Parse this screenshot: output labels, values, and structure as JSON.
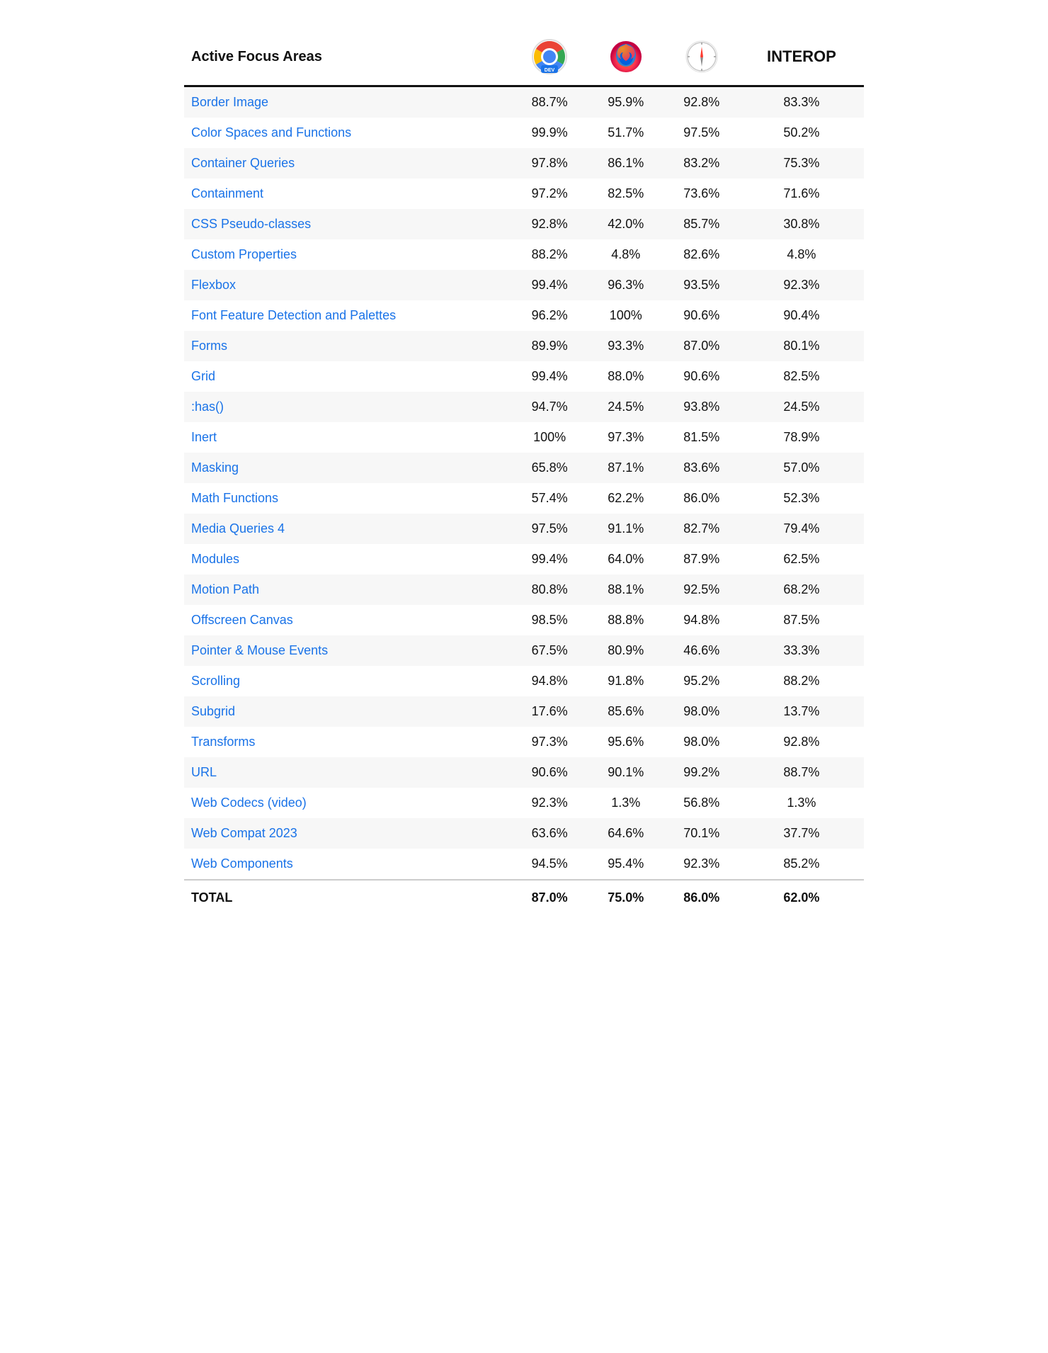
{
  "header": {
    "col_name": "Active Focus Areas",
    "col_interop": "INTEROP"
  },
  "rows": [
    {
      "name": "Border Image",
      "chrome": "88.7%",
      "firefox": "95.9%",
      "safari": "92.8%",
      "interop": "83.3%"
    },
    {
      "name": "Color Spaces and Functions",
      "chrome": "99.9%",
      "firefox": "51.7%",
      "safari": "97.5%",
      "interop": "50.2%"
    },
    {
      "name": "Container Queries",
      "chrome": "97.8%",
      "firefox": "86.1%",
      "safari": "83.2%",
      "interop": "75.3%"
    },
    {
      "name": "Containment",
      "chrome": "97.2%",
      "firefox": "82.5%",
      "safari": "73.6%",
      "interop": "71.6%"
    },
    {
      "name": "CSS Pseudo-classes",
      "chrome": "92.8%",
      "firefox": "42.0%",
      "safari": "85.7%",
      "interop": "30.8%"
    },
    {
      "name": "Custom Properties",
      "chrome": "88.2%",
      "firefox": "4.8%",
      "safari": "82.6%",
      "interop": "4.8%"
    },
    {
      "name": "Flexbox",
      "chrome": "99.4%",
      "firefox": "96.3%",
      "safari": "93.5%",
      "interop": "92.3%"
    },
    {
      "name": "Font Feature Detection and Palettes",
      "chrome": "96.2%",
      "firefox": "100%",
      "safari": "90.6%",
      "interop": "90.4%"
    },
    {
      "name": "Forms",
      "chrome": "89.9%",
      "firefox": "93.3%",
      "safari": "87.0%",
      "interop": "80.1%"
    },
    {
      "name": "Grid",
      "chrome": "99.4%",
      "firefox": "88.0%",
      "safari": "90.6%",
      "interop": "82.5%"
    },
    {
      "name": ":has()",
      "chrome": "94.7%",
      "firefox": "24.5%",
      "safari": "93.8%",
      "interop": "24.5%"
    },
    {
      "name": "Inert",
      "chrome": "100%",
      "firefox": "97.3%",
      "safari": "81.5%",
      "interop": "78.9%"
    },
    {
      "name": "Masking",
      "chrome": "65.8%",
      "firefox": "87.1%",
      "safari": "83.6%",
      "interop": "57.0%"
    },
    {
      "name": "Math Functions",
      "chrome": "57.4%",
      "firefox": "62.2%",
      "safari": "86.0%",
      "interop": "52.3%"
    },
    {
      "name": "Media Queries 4",
      "chrome": "97.5%",
      "firefox": "91.1%",
      "safari": "82.7%",
      "interop": "79.4%"
    },
    {
      "name": "Modules",
      "chrome": "99.4%",
      "firefox": "64.0%",
      "safari": "87.9%",
      "interop": "62.5%"
    },
    {
      "name": "Motion Path",
      "chrome": "80.8%",
      "firefox": "88.1%",
      "safari": "92.5%",
      "interop": "68.2%"
    },
    {
      "name": "Offscreen Canvas",
      "chrome": "98.5%",
      "firefox": "88.8%",
      "safari": "94.8%",
      "interop": "87.5%"
    },
    {
      "name": "Pointer & Mouse Events",
      "chrome": "67.5%",
      "firefox": "80.9%",
      "safari": "46.6%",
      "interop": "33.3%"
    },
    {
      "name": "Scrolling",
      "chrome": "94.8%",
      "firefox": "91.8%",
      "safari": "95.2%",
      "interop": "88.2%"
    },
    {
      "name": "Subgrid",
      "chrome": "17.6%",
      "firefox": "85.6%",
      "safari": "98.0%",
      "interop": "13.7%"
    },
    {
      "name": "Transforms",
      "chrome": "97.3%",
      "firefox": "95.6%",
      "safari": "98.0%",
      "interop": "92.8%"
    },
    {
      "name": "URL",
      "chrome": "90.6%",
      "firefox": "90.1%",
      "safari": "99.2%",
      "interop": "88.7%"
    },
    {
      "name": "Web Codecs (video)",
      "chrome": "92.3%",
      "firefox": "1.3%",
      "safari": "56.8%",
      "interop": "1.3%"
    },
    {
      "name": "Web Compat 2023",
      "chrome": "63.6%",
      "firefox": "64.6%",
      "safari": "70.1%",
      "interop": "37.7%"
    },
    {
      "name": "Web Components",
      "chrome": "94.5%",
      "firefox": "95.4%",
      "safari": "92.3%",
      "interop": "85.2%"
    },
    {
      "name": "TOTAL",
      "chrome": "87.0%",
      "firefox": "75.0%",
      "safari": "86.0%",
      "interop": "62.0%",
      "isTotal": true
    }
  ]
}
